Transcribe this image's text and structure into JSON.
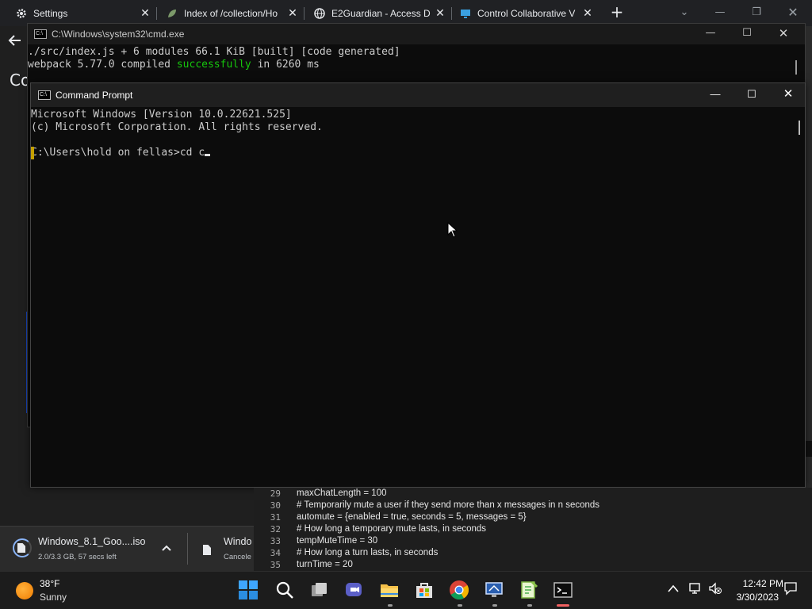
{
  "browser": {
    "tabs": [
      {
        "label": "Settings",
        "icon": "gear-icon"
      },
      {
        "label": "Index of /collection/Ho",
        "icon": "leaf-icon"
      },
      {
        "label": "E2Guardian - Access D",
        "icon": "globe-icon"
      },
      {
        "label": "Control Collaborative V",
        "icon": "monitor-icon"
      }
    ],
    "page_partial_text": "Co"
  },
  "cmd_back": {
    "title": "C:\\Windows\\system32\\cmd.exe",
    "line1": "./src/index.js + 6 modules 66.1 KiB [built] [code generated]",
    "line2_prefix": "webpack 5.77.0 compiled ",
    "line2_status": "successfully",
    "line2_suffix": " in 6260 ms"
  },
  "cmd_front": {
    "title": "Command Prompt",
    "line1": "Microsoft Windows [Version 10.0.22621.525]",
    "line2": "(c) Microsoft Corporation. All rights reserved.",
    "prompt": "C:\\Users\\hold on fellas>",
    "typed": "cd c"
  },
  "editor": {
    "lines": [
      {
        "num": "29",
        "text": "maxChatLength = 100"
      },
      {
        "num": "30",
        "text": "# Temporarily mute a user if they send more than x messages in n seconds"
      },
      {
        "num": "31",
        "text": "automute = {enabled = true, seconds = 5, messages = 5}"
      },
      {
        "num": "32",
        "text": "# How long a temporary mute lasts, in seconds"
      },
      {
        "num": "33",
        "text": "tempMuteTime = 30"
      },
      {
        "num": "34",
        "text": "# How long a turn lasts, in seconds"
      },
      {
        "num": "35",
        "text": "turnTime = 20"
      }
    ]
  },
  "downloads": {
    "item1": {
      "name": "Windows_8.1_Goo....iso",
      "status": "2.0/3.3 GB, 57 secs left",
      "progress": 0.6
    },
    "item2": {
      "name": "Windo",
      "status": "Cancele"
    }
  },
  "taskbar": {
    "weather_temp": "38°F",
    "weather_cond": "Sunny",
    "clock_time": "12:42 PM",
    "clock_date": "3/30/2023",
    "accent": "#0078d4"
  }
}
